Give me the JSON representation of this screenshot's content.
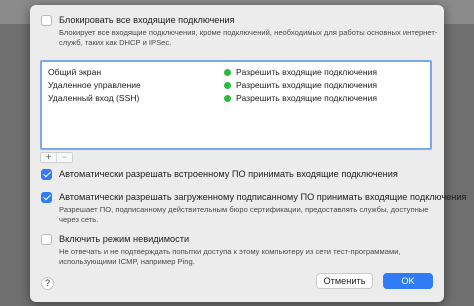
{
  "block_all": {
    "label": "Блокировать все входящие подключения",
    "checked": false,
    "description": [
      "Блокирует все входящие подключения, кроме подключений, необходимых для работы основных интернет-",
      "служб, таких как DHCP и IPSec."
    ]
  },
  "services": [
    {
      "name": "Общий экран",
      "status": "Разрешить входящие подключения",
      "status_color": "#2bbb3b"
    },
    {
      "name": "Удаленное управление",
      "status": "Разрешить входящие подключения",
      "status_color": "#2bbb3b"
    },
    {
      "name": "Удаленный вход (SSH)",
      "status": "Разрешить входящие подключения",
      "status_color": "#2bbb3b"
    }
  ],
  "list_controls": {
    "add": "+",
    "remove": "−"
  },
  "auto_builtin": {
    "label": "Автоматически разрешать встроенному ПО принимать входящие подключения",
    "checked": true
  },
  "auto_signed": {
    "label": "Автоматически разрешать загруженному подписанному ПО принимать входящие подключения",
    "checked": true,
    "description": [
      "Разрешает ПО, подписанному действительным бюро сертификации, предоставлять службы, доступные",
      "через сеть."
    ]
  },
  "stealth": {
    "label": "Включить режим невидимости",
    "checked": false,
    "description": [
      "Не отвечать и не подтверждать попытки доступа к этому компьютеру из сети тест-программами,",
      "использующими ICMP, например Ping."
    ]
  },
  "footer": {
    "help": "?",
    "cancel": "Отменить",
    "ok": "OK"
  },
  "colors": {
    "accent": "#2f7cf6",
    "allow": "#2bbb3b"
  }
}
